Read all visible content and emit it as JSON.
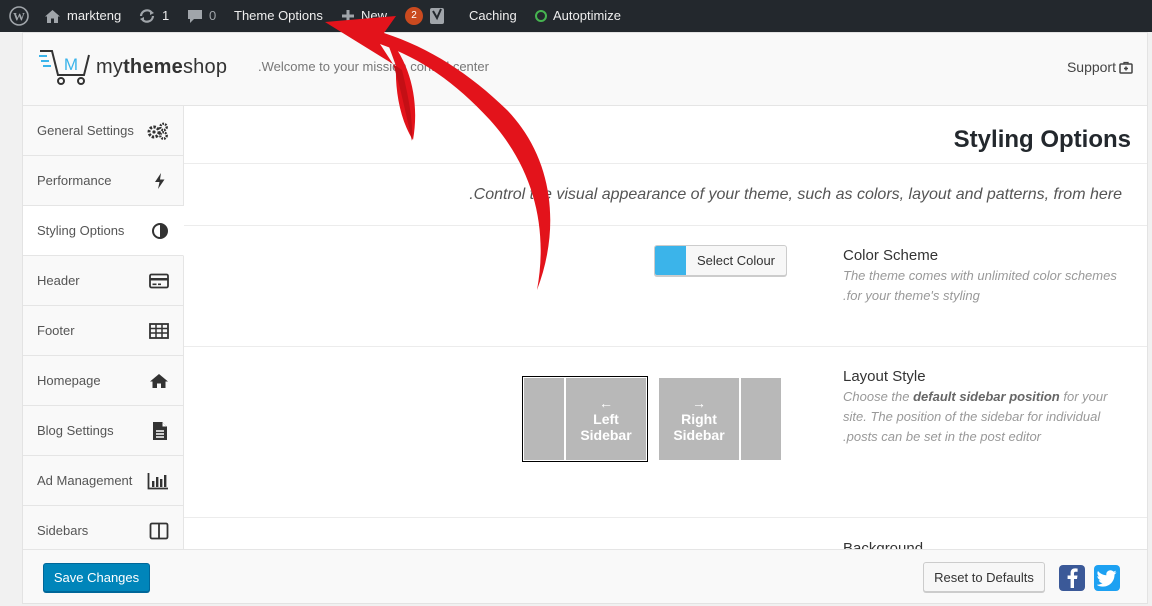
{
  "adminbar": {
    "site_name": "markteng",
    "updates_count": "1",
    "comments_count": "0",
    "theme_options": "Theme Options",
    "new_label": "New",
    "seo_badge": "2",
    "caching": "Caching",
    "autoptimize": "Autoptimize"
  },
  "header": {
    "logo_regular": "my",
    "logo_bold": "theme",
    "logo_tail": "shop",
    "welcome": ".Welcome to your mission control center",
    "support": "Support"
  },
  "sidebar": {
    "items": [
      {
        "label": "General Settings",
        "icon": "cogs-icon"
      },
      {
        "label": "Performance",
        "icon": "bolt-icon"
      },
      {
        "label": "Styling Options",
        "icon": "contrast-icon"
      },
      {
        "label": "Header",
        "icon": "card-icon"
      },
      {
        "label": "Footer",
        "icon": "table-icon"
      },
      {
        "label": "Homepage",
        "icon": "home-icon"
      },
      {
        "label": "Blog Settings",
        "icon": "document-icon"
      },
      {
        "label": "Ad Management",
        "icon": "bar-chart-icon"
      },
      {
        "label": "Sidebars",
        "icon": "columns-icon"
      }
    ]
  },
  "main": {
    "title": "Styling Options",
    "intro": ".Control the visual appearance of your theme, such as colors, layout and patterns, from here",
    "color_scheme": {
      "button_label": "Select Colour",
      "swatch_color": "#3bb4ea",
      "title": "Color Scheme",
      "desc_line1": "The theme comes with unlimited color schemes",
      "desc_line2": ".for your theme's styling"
    },
    "layout_style": {
      "title": "Layout Style",
      "desc_pre": "Choose the ",
      "desc_bold": "default sidebar position",
      "desc_post": " for your",
      "desc_line2": "site. The position of the sidebar for individual",
      "desc_line3": ".posts can be set in the post editor",
      "left_arrow": "←",
      "left_label_1": "Left",
      "left_label_2": "Sidebar",
      "right_arrow": "→",
      "right_label_1": "Right",
      "right_label_2": "Sidebar"
    },
    "background": {
      "title": "Background"
    }
  },
  "footer": {
    "save": "Save Changes",
    "reset": "Reset to Defaults"
  },
  "colors": {
    "accent": "#0085ba",
    "arrow": "#e3131b"
  }
}
